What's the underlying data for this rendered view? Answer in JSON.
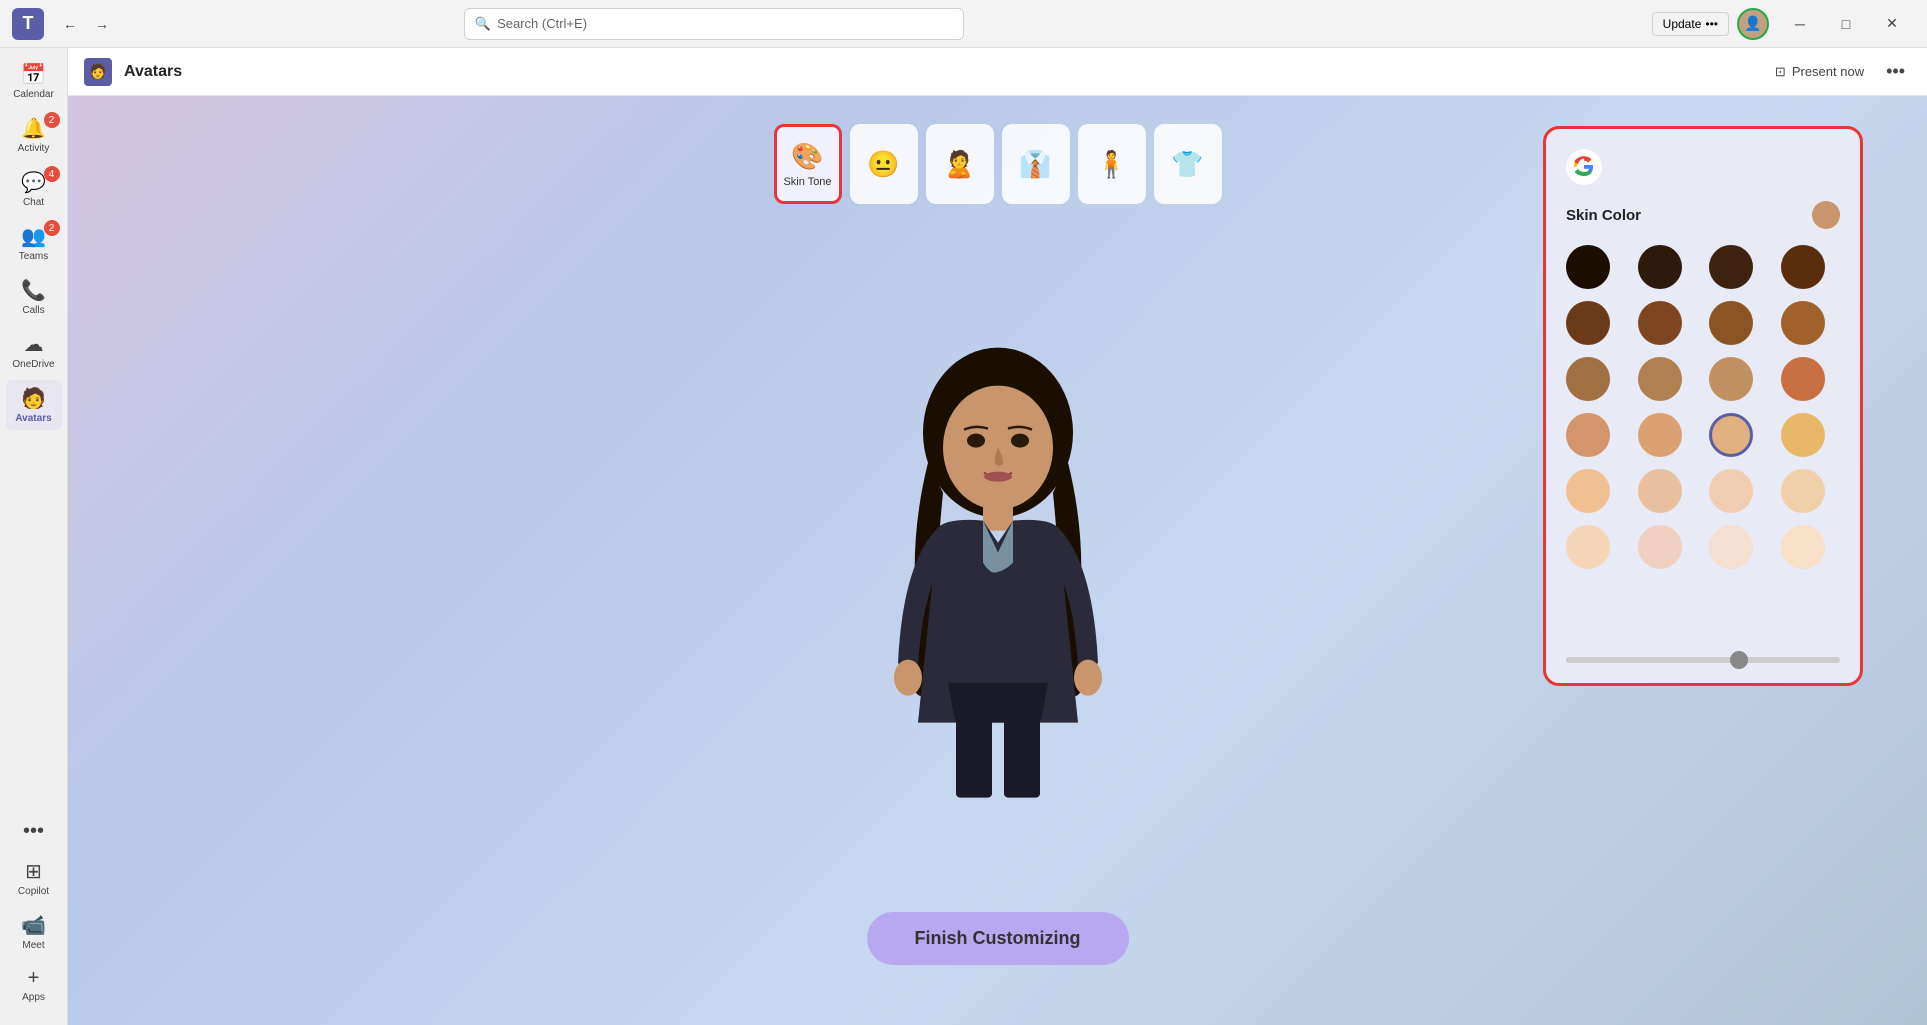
{
  "titlebar": {
    "logo": "T",
    "back_label": "←",
    "forward_label": "→",
    "search_placeholder": "Search (Ctrl+E)",
    "update_label": "Update",
    "update_dots": "•••",
    "minimize_label": "─",
    "maximize_label": "□",
    "close_label": "✕"
  },
  "sidebar": {
    "items": [
      {
        "id": "calendar",
        "label": "Calendar",
        "icon": "▦",
        "badge": null
      },
      {
        "id": "activity",
        "label": "Activity",
        "icon": "🔔",
        "badge": "2"
      },
      {
        "id": "chat",
        "label": "Chat",
        "icon": "💬",
        "badge": "4"
      },
      {
        "id": "teams",
        "label": "Teams",
        "icon": "👥",
        "badge": "2"
      },
      {
        "id": "calls",
        "label": "Calls",
        "icon": "📞",
        "badge": null
      },
      {
        "id": "onedrive",
        "label": "OneDrive",
        "icon": "☁",
        "badge": null
      },
      {
        "id": "avatars",
        "label": "Avatars",
        "icon": "🧑",
        "badge": null,
        "active": true
      }
    ],
    "bottom_items": [
      {
        "id": "more",
        "label": "•••",
        "icon": "•••"
      },
      {
        "id": "apps",
        "label": "Apps",
        "icon": "+"
      },
      {
        "id": "meet",
        "label": "Meet",
        "icon": "📹"
      },
      {
        "id": "copilot",
        "label": "Copilot",
        "icon": "⊞"
      }
    ]
  },
  "header": {
    "icon": "🧑",
    "title": "Avatars",
    "present_label": "Present now",
    "more_label": "•••"
  },
  "toolbar": {
    "items": [
      {
        "id": "skin-tone",
        "label": "Skin Tone",
        "icon": "🎨",
        "active": true
      },
      {
        "id": "face",
        "label": "",
        "icon": "😐"
      },
      {
        "id": "head",
        "label": "",
        "icon": "🙎"
      },
      {
        "id": "body",
        "label": "",
        "icon": "👔"
      },
      {
        "id": "accessories",
        "label": "",
        "icon": "🎒"
      },
      {
        "id": "outfit",
        "label": "",
        "icon": "👕"
      }
    ],
    "undo": "↺",
    "redo": "↻",
    "close": "✕"
  },
  "skin_panel": {
    "title": "Skin Color",
    "selected_color": "#c8956c",
    "colors": [
      "#1a0e00",
      "#2d1a0a",
      "#3d2210",
      "#5a2d0c",
      "#6b3a18",
      "#7d4520",
      "#8b5523",
      "#a0622a",
      "#a07040",
      "#b08050",
      "#c09060",
      "#c87040",
      "#d4956a",
      "#daa070",
      "#e0b080",
      "#e8b868",
      "#f0c090",
      "#e8c0a0",
      "#f0cdb0",
      "#f0d0a8",
      "#f5d5b8",
      "#f0d0c0",
      "#f5dfd0",
      "#f8e0c8"
    ],
    "slider_value": 60
  },
  "finish_button": {
    "label": "Finish Customizing"
  }
}
